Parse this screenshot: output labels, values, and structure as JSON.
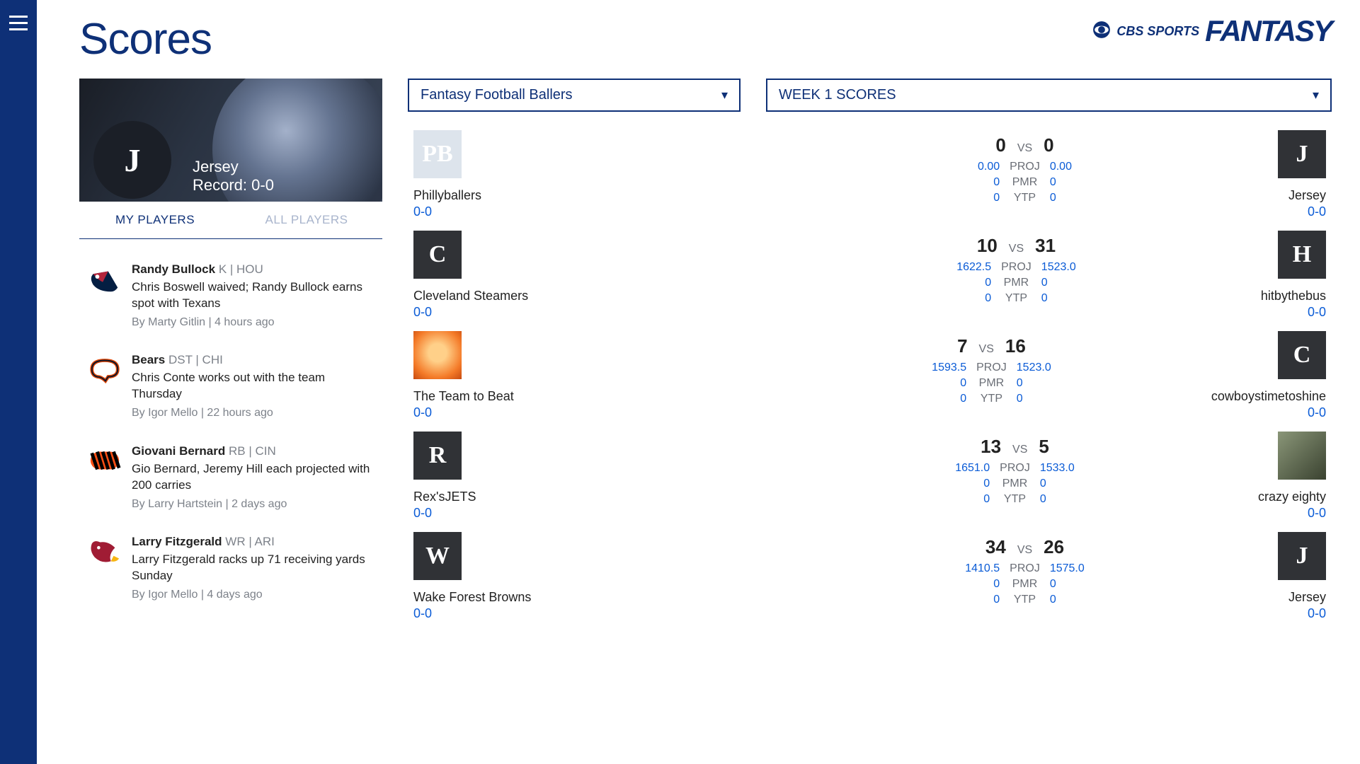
{
  "header": {
    "title": "Scores",
    "logo_brand": "CBS SPORTS",
    "logo_fantasy": "FANTASY"
  },
  "hero": {
    "initial": "J",
    "team": "Jersey",
    "record_label": "Record: 0-0"
  },
  "tabs": {
    "my_players": "MY PLAYERS",
    "all_players": "ALL PLAYERS"
  },
  "news": [
    {
      "player": "Randy Bullock",
      "pos": "K | HOU",
      "headline": "Chris Boswell waived; Randy Bullock earns spot with Texans",
      "byline": "By Marty Gitlin | 4 hours ago",
      "logo": "texans"
    },
    {
      "player": "Bears",
      "pos": "DST | CHI",
      "headline": "Chris Conte works out with the team Thursday",
      "byline": "By Igor Mello | 22 hours ago",
      "logo": "bears"
    },
    {
      "player": "Giovani Bernard",
      "pos": "RB | CIN",
      "headline": "Gio Bernard, Jeremy Hill each projected with 200 carries",
      "byline": "By Larry Hartstein | 2 days ago",
      "logo": "bengals"
    },
    {
      "player": "Larry Fitzgerald",
      "pos": "WR | ARI",
      "headline": "Larry Fitzgerald racks up 71 receiving yards Sunday",
      "byline": "By Igor Mello | 4 days ago",
      "logo": "cardinals"
    }
  ],
  "dropdowns": {
    "league": "Fantasy Football Ballers",
    "week": "WEEK 1 SCORES"
  },
  "labels": {
    "vs": "VS",
    "proj": "PROJ",
    "pmr": "PMR",
    "ytp": "YTP"
  },
  "matchups": [
    {
      "team_a": "Phillyballers",
      "rec_a": "0-0",
      "avinit_a": "PB",
      "avclass_a": "pb-helmet",
      "team_b": "Jersey",
      "rec_b": "0-0",
      "avinit_b": "J",
      "score_a": "0",
      "score_b": "0",
      "proj_a": "0.00",
      "proj_b": "0.00",
      "pmr_a": "0",
      "pmr_b": "0",
      "ytp_a": "0",
      "ytp_b": "0"
    },
    {
      "team_a": "Cleveland Steamers",
      "rec_a": "0-0",
      "avinit_a": "C",
      "team_b": "hitbythebus",
      "rec_b": "0-0",
      "avinit_b": "H",
      "score_a": "10",
      "score_b": "31",
      "proj_a": "1622.5",
      "proj_b": "1523.0",
      "pmr_a": "0",
      "pmr_b": "0",
      "ytp_a": "0",
      "ytp_b": "0"
    },
    {
      "team_a": "The Team to Beat",
      "rec_a": "0-0",
      "avinit_a": "",
      "avclass_a": "orange-circ",
      "team_b": "cowboystimetoshine",
      "rec_b": "0-0",
      "avinit_b": "C",
      "score_a": "7",
      "score_b": "16",
      "proj_a": "1593.5",
      "proj_b": "1523.0",
      "pmr_a": "0",
      "pmr_b": "0",
      "ytp_a": "0",
      "ytp_b": "0"
    },
    {
      "team_a": "Rex'sJETS",
      "rec_a": "0-0",
      "avinit_a": "R",
      "team_b": "crazy eighty",
      "rec_b": "0-0",
      "avinit_b": "",
      "avclass_b": "photo",
      "score_a": "13",
      "score_b": "5",
      "proj_a": "1651.0",
      "proj_b": "1533.0",
      "pmr_a": "0",
      "pmr_b": "0",
      "ytp_a": "0",
      "ytp_b": "0"
    },
    {
      "team_a": "Wake Forest Browns",
      "rec_a": "0-0",
      "avinit_a": "W",
      "team_b": "Jersey",
      "rec_b": "0-0",
      "avinit_b": "J",
      "score_a": "34",
      "score_b": "26",
      "proj_a": "1410.5",
      "proj_b": "1575.0",
      "pmr_a": "0",
      "pmr_b": "0",
      "ytp_a": "0",
      "ytp_b": "0"
    }
  ]
}
